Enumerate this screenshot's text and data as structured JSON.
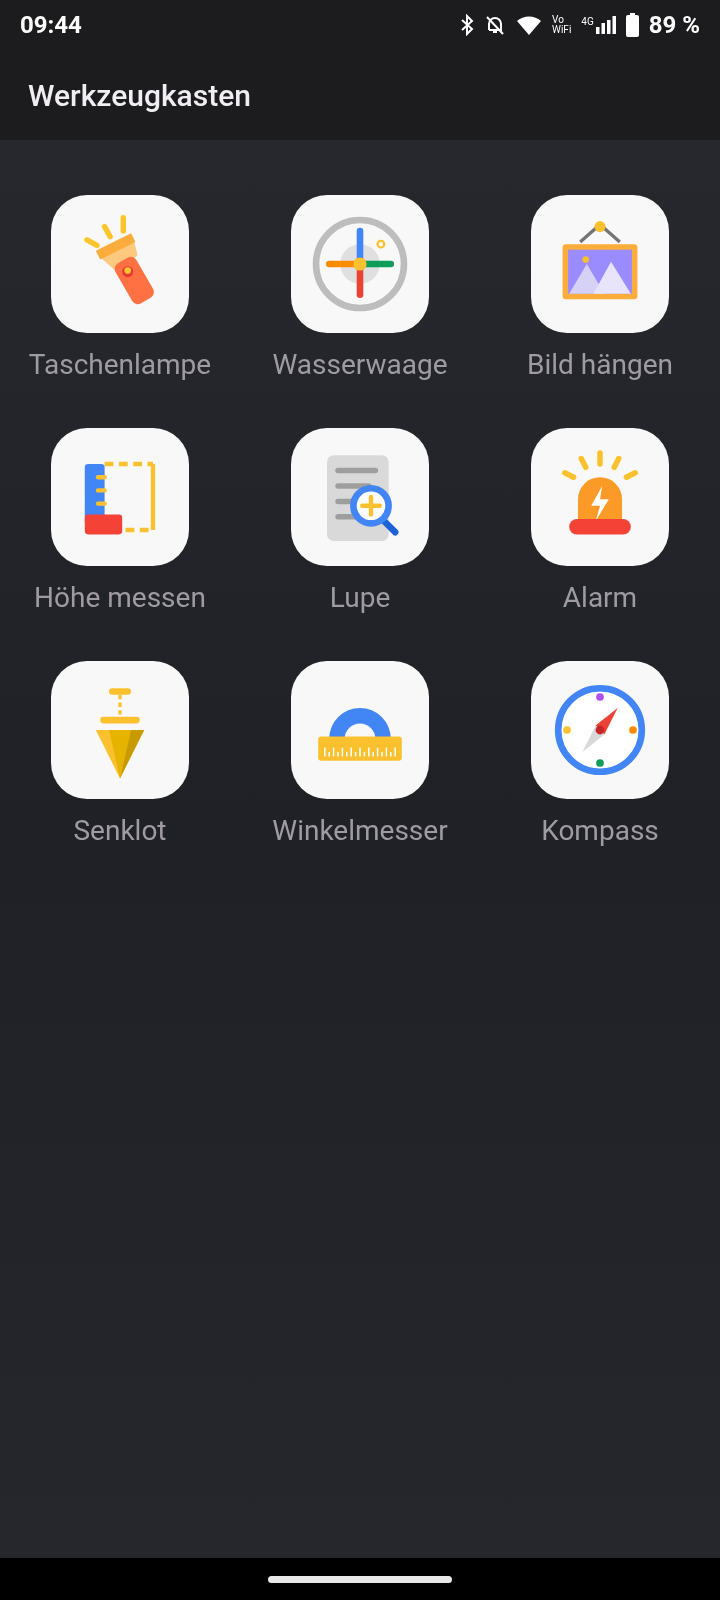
{
  "status_bar": {
    "time": "09:44",
    "vowifi": [
      "Vo",
      "WiFi"
    ],
    "network": "4G",
    "battery": "89 %"
  },
  "app_bar": {
    "title": "Werkzeugkasten"
  },
  "tools": [
    {
      "kind": "flashlight",
      "label": "Taschenlampe"
    },
    {
      "kind": "level",
      "label": "Wasserwaage"
    },
    {
      "kind": "picture_frame",
      "label": "Bild hängen"
    },
    {
      "kind": "ruler",
      "label": "Höhe messen"
    },
    {
      "kind": "magnifier",
      "label": "Lupe"
    },
    {
      "kind": "alarm",
      "label": "Alarm"
    },
    {
      "kind": "plumb",
      "label": "Senklot"
    },
    {
      "kind": "protractor",
      "label": "Winkelmesser"
    },
    {
      "kind": "compass",
      "label": "Kompass"
    }
  ]
}
